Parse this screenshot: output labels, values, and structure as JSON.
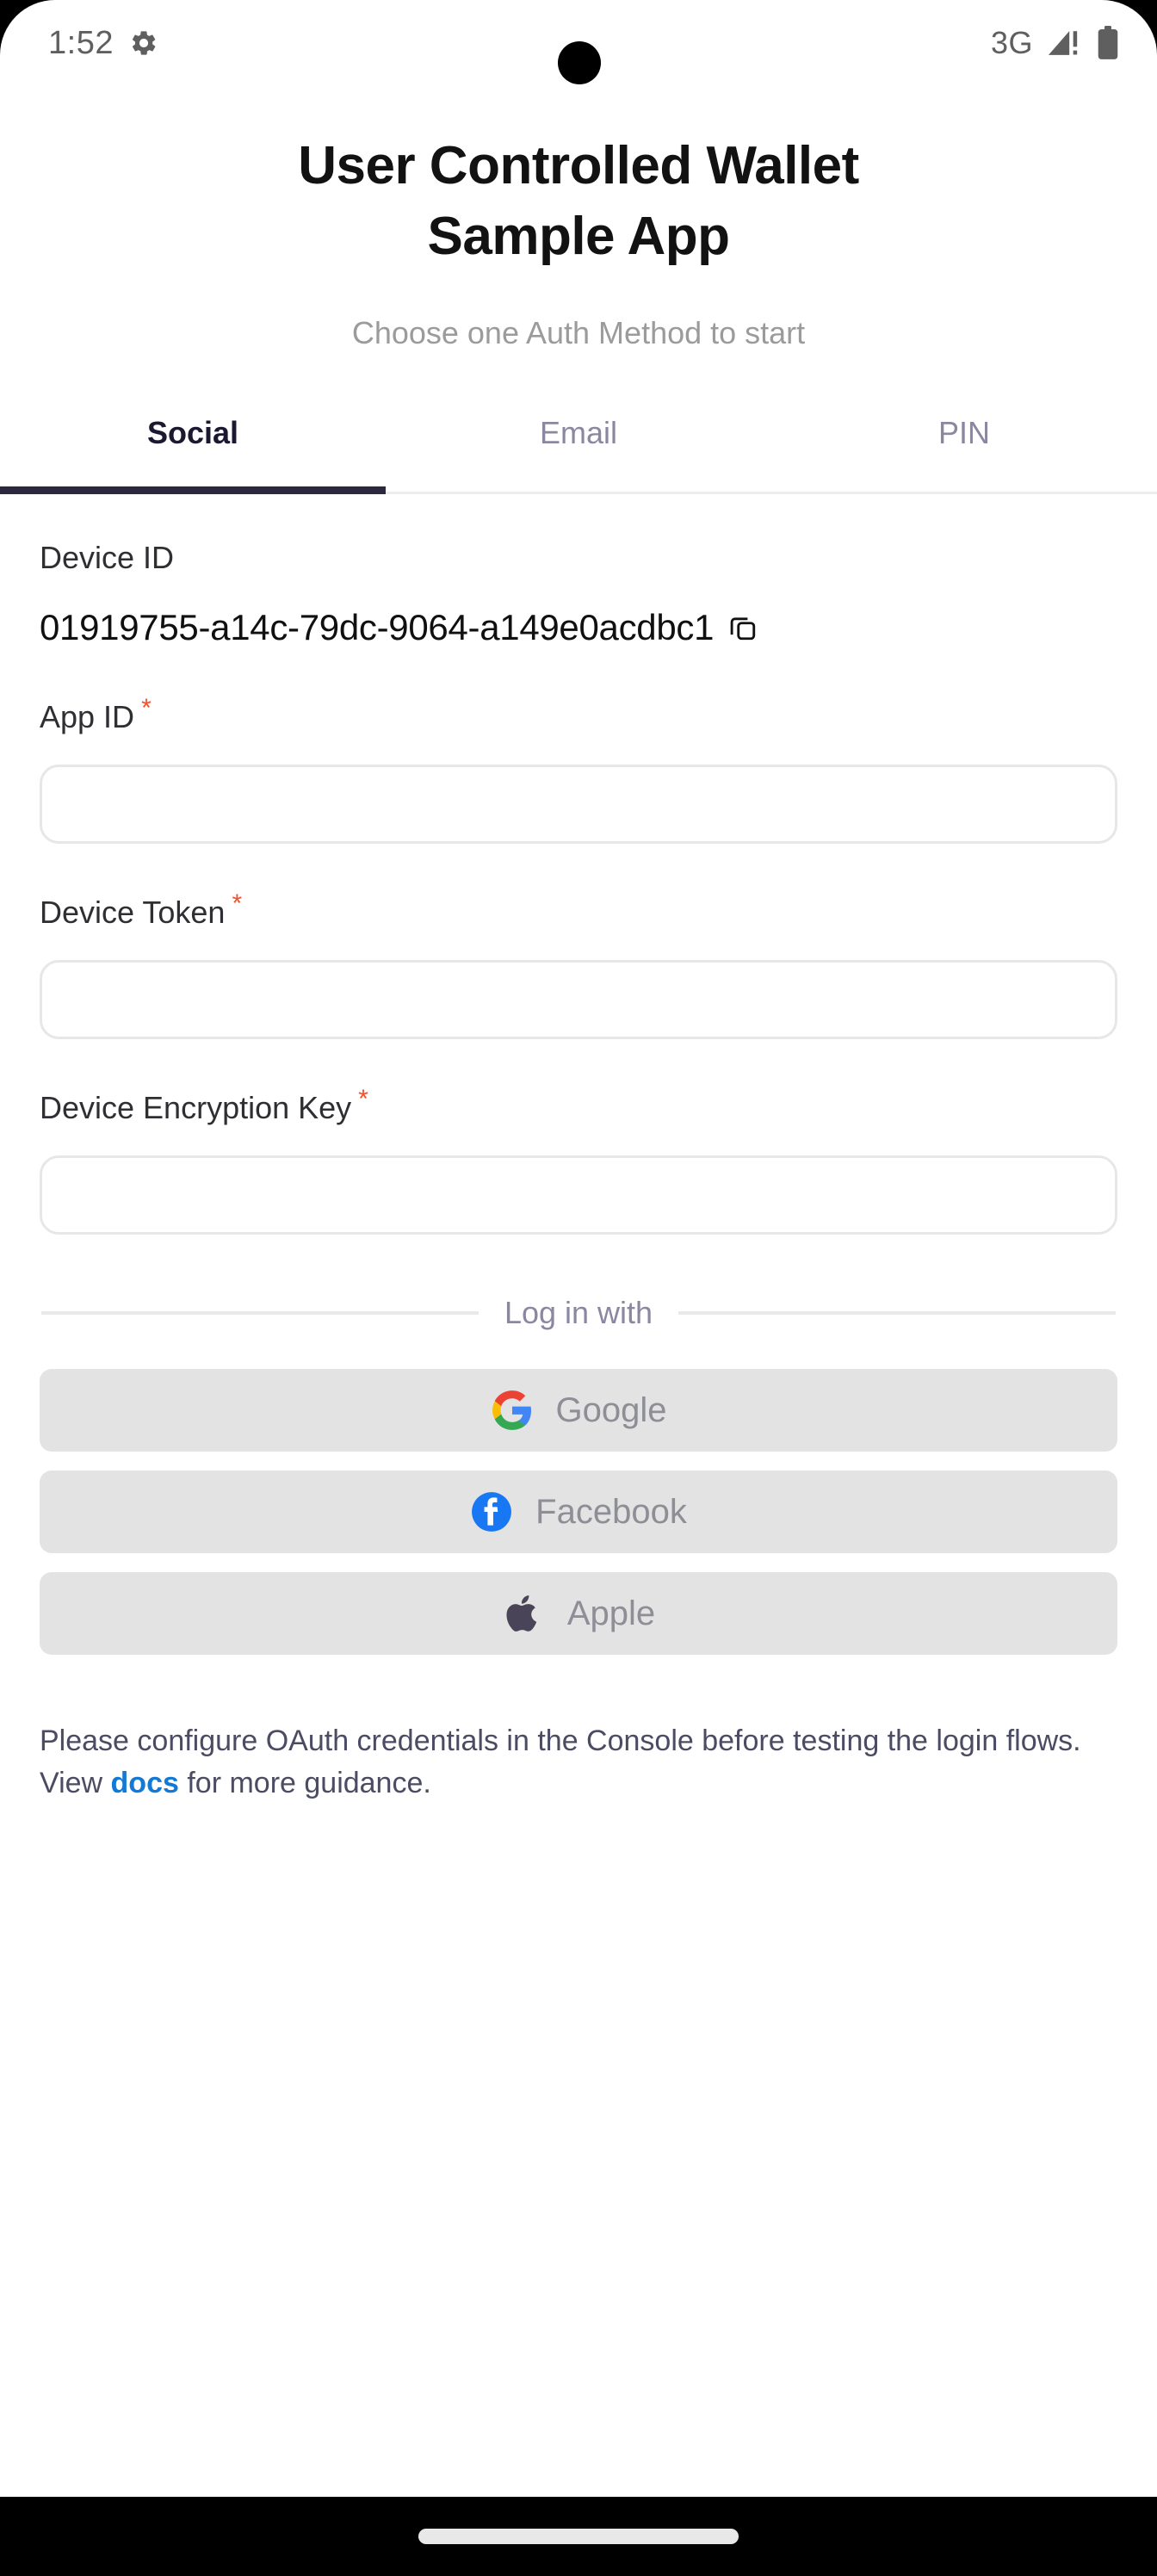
{
  "status_bar": {
    "time": "1:52",
    "gear_icon": "gear-icon",
    "network": "3G",
    "signal_icon": "signal-warning-icon",
    "battery_icon": "battery-icon"
  },
  "header": {
    "title_line1": "User Controlled Wallet",
    "title_line2": "Sample App",
    "subtitle": "Choose one Auth Method to start"
  },
  "tabs": {
    "active_index": 0,
    "items": [
      {
        "label": "Social"
      },
      {
        "label": "Email"
      },
      {
        "label": "PIN"
      }
    ]
  },
  "form": {
    "device_id": {
      "label": "Device ID",
      "value": "01919755-a14c-79dc-9064-a149e0acdbc1",
      "copy_icon": "copy-icon"
    },
    "fields": [
      {
        "label": "App ID",
        "required": "*",
        "value": "",
        "placeholder": ""
      },
      {
        "label": "Device Token",
        "required": "*",
        "value": "",
        "placeholder": ""
      },
      {
        "label": "Device Encryption Key",
        "required": "*",
        "value": "",
        "placeholder": ""
      }
    ]
  },
  "divider": {
    "text": "Log in with"
  },
  "social_buttons": [
    {
      "label": "Google",
      "icon": "google-icon"
    },
    {
      "label": "Facebook",
      "icon": "facebook-icon"
    },
    {
      "label": "Apple",
      "icon": "apple-icon"
    }
  ],
  "footer": {
    "text_before": "Please configure OAuth credentials in the Console before testing the login flows. View ",
    "link": "docs",
    "text_after": " for more guidance."
  },
  "colors": {
    "accent_underline": "#2b2840",
    "required_asterisk": "#f2512c",
    "link": "#1479d4",
    "button_bg": "#e3e3e3",
    "button_text": "#8e8e96"
  }
}
